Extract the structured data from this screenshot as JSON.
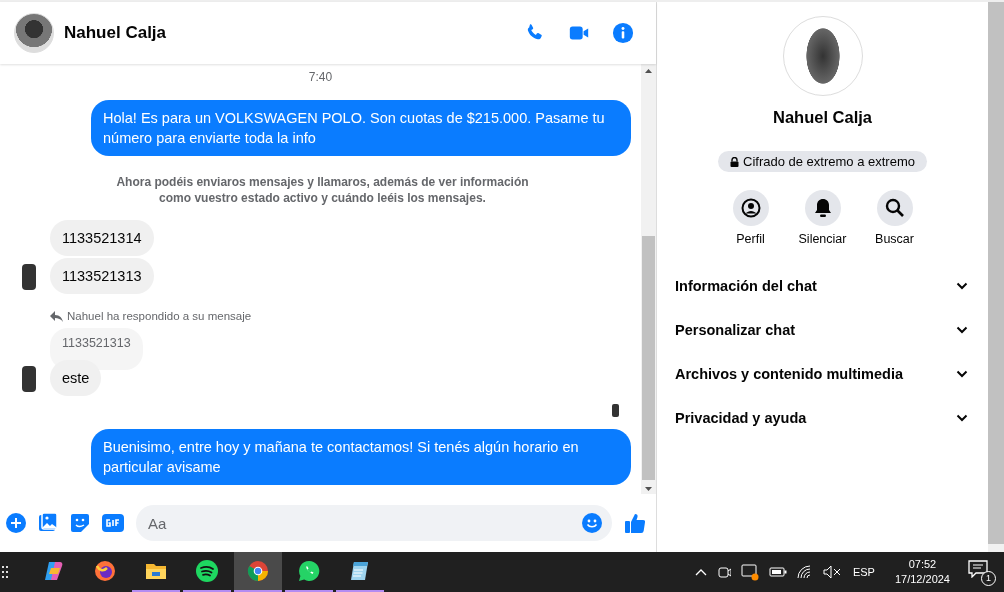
{
  "header": {
    "name": "Nahuel Calja"
  },
  "messages": [
    {
      "kind": "time",
      "text": "7:40"
    },
    {
      "kind": "outgoing",
      "text": "Hola! Es para un VOLKSWAGEN POLO. Son cuotas de $215.000. Pasame tu número para enviarte toda la info"
    },
    {
      "kind": "notice",
      "text": "Ahora podéis enviaros mensajes y llamaros, además de ver información como vuestro estado activo y cuándo leéis los mensajes."
    },
    {
      "kind": "incoming",
      "text": "1133521314",
      "avatar": false
    },
    {
      "kind": "incoming",
      "text": "1133521313",
      "avatar": true
    },
    {
      "kind": "reply_note",
      "text": "Nahuel ha respondido a su mensaje"
    },
    {
      "kind": "quoted",
      "text": "1133521313"
    },
    {
      "kind": "incoming",
      "text": "este",
      "avatar": true
    },
    {
      "kind": "seen"
    },
    {
      "kind": "outgoing",
      "text": "Buenisimo, entre hoy y mañana te contactamos! Si tenés algún horario en particular avisame"
    }
  ],
  "composer": {
    "placeholder": "Aa"
  },
  "panel": {
    "name": "Nahuel Calja",
    "encryption": "Cifrado de extremo a extremo",
    "actions": [
      {
        "kind": "profile",
        "label": "Perfil"
      },
      {
        "kind": "mute",
        "label": "Silenciar"
      },
      {
        "kind": "search",
        "label": "Buscar"
      }
    ],
    "sections": [
      {
        "label": "Información del chat",
        "expanded": false
      },
      {
        "label": "Personalizar chat",
        "expanded": false
      },
      {
        "label": "Archivos y contenido multimedia",
        "expanded": false
      },
      {
        "label": "Privacidad y ayuda",
        "expanded": false
      }
    ]
  },
  "taskbar": {
    "apps": [
      {
        "kind": "copilot",
        "open": false,
        "selected": false
      },
      {
        "kind": "firefox",
        "open": false,
        "selected": false
      },
      {
        "kind": "files",
        "open": true,
        "selected": false
      },
      {
        "kind": "spotify",
        "open": true,
        "selected": false
      },
      {
        "kind": "chrome",
        "open": true,
        "selected": true
      },
      {
        "kind": "whatsapp",
        "open": true,
        "selected": false
      },
      {
        "kind": "notepad",
        "open": true,
        "selected": false
      }
    ],
    "language": "ESP",
    "time": "07:52",
    "date": "17/12/2024",
    "notifications": "1"
  }
}
